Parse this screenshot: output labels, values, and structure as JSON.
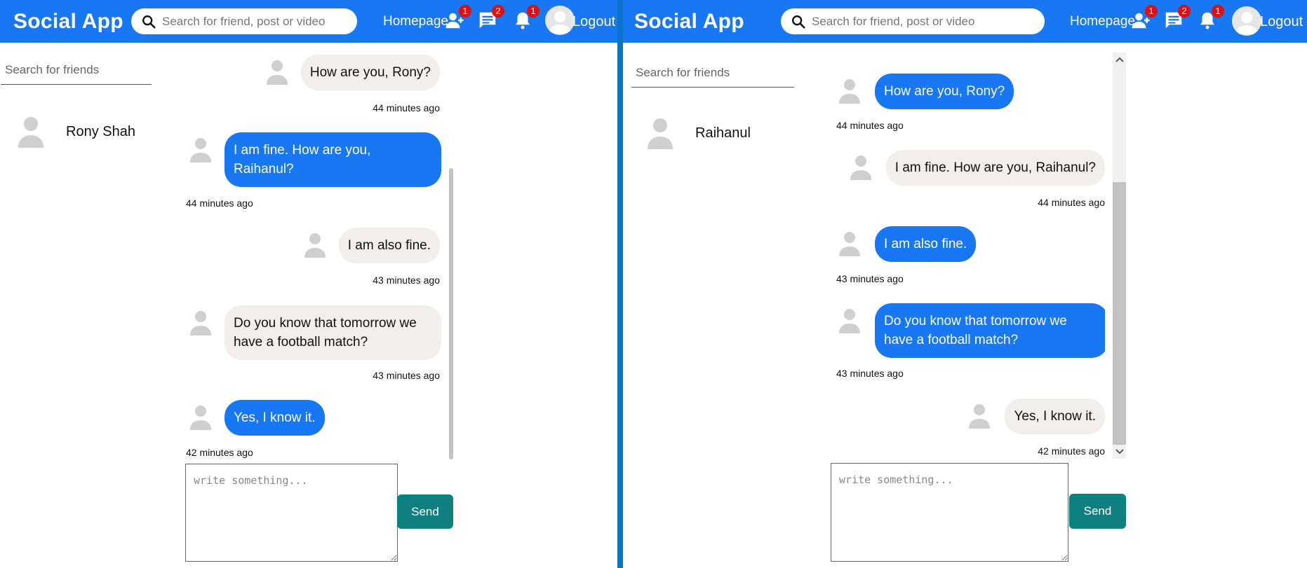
{
  "left": {
    "brand": "Social App",
    "search_placeholder": "Search for friend, post or video",
    "nav": {
      "homepage": "Homepage",
      "friend_badge": "1",
      "message_badge": "2",
      "notification_badge": "1",
      "logout": "Logout"
    },
    "friend_search_placeholder": "Search for friends",
    "friends": [
      {
        "name": "Rony Shah"
      }
    ],
    "messages": [
      {
        "text": "How are you, Rony?",
        "time": "44 minutes ago"
      },
      {
        "text": "I am fine. How are you, Raihanul?",
        "time": "44 minutes ago"
      },
      {
        "text": "I am also fine.",
        "time": "43 minutes ago"
      },
      {
        "text": "Do you know that tomorrow we have a football match?",
        "time": "43 minutes ago"
      },
      {
        "text": "Yes, I know it.",
        "time": "42 minutes ago"
      }
    ],
    "compose_placeholder": "write something...",
    "send_label": "Send"
  },
  "right": {
    "brand": "Social App",
    "search_placeholder": "Search for friend, post or video",
    "nav": {
      "homepage": "Homepage",
      "friend_badge": "1",
      "message_badge": "2",
      "notification_badge": "1",
      "logout": "Logout"
    },
    "friend_search_placeholder": "Search for friends",
    "friends": [
      {
        "name": "Raihanul"
      }
    ],
    "messages": [
      {
        "text": "How are you, Rony?",
        "time": "44 minutes ago"
      },
      {
        "text": "I am fine. How are you, Raihanul?",
        "time": "44 minutes ago"
      },
      {
        "text": "I am also fine.",
        "time": "43 minutes ago"
      },
      {
        "text": "Do you know that tomorrow we have a football match?",
        "time": "43 minutes ago"
      },
      {
        "text": "Yes, I know it.",
        "time": "42 minutes ago"
      }
    ],
    "compose_placeholder": "write something...",
    "send_label": "Send"
  },
  "colors": {
    "topbar": "#1877f2",
    "divider": "#0a74c9",
    "bubble_blue": "#1877f2",
    "bubble_grey": "#f2eeee",
    "send": "#0f8080",
    "badge": "#e01010"
  },
  "icons": [
    "search-icon",
    "friend-request-icon",
    "message-icon",
    "notification-icon",
    "user-avatar-icon",
    "resize-handle-icon",
    "scroll-up-icon",
    "scroll-down-icon"
  ]
}
